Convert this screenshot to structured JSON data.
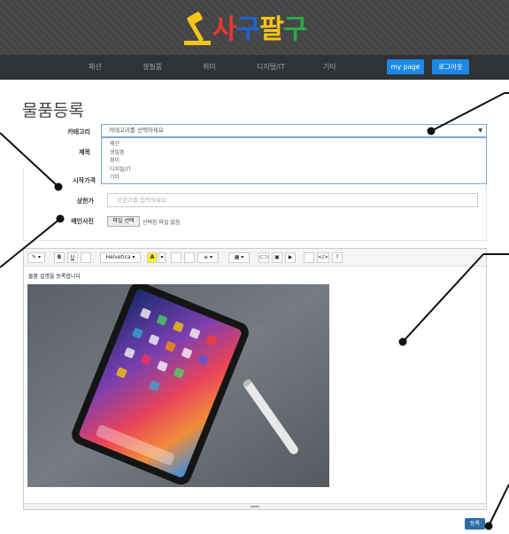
{
  "header": {
    "logo_text_1": "사",
    "logo_text_2": "구",
    "logo_text_3": "팔",
    "logo_text_4": "구",
    "nav": [
      {
        "label": "패션"
      },
      {
        "label": "생필품"
      },
      {
        "label": "취미"
      },
      {
        "label": "디지털/IT"
      },
      {
        "label": "기타"
      }
    ],
    "mypage_label": "my page",
    "logout_label": "로그아웃"
  },
  "page": {
    "title": "물품등록"
  },
  "form": {
    "category_label": "카테고리",
    "category_placeholder": "카테고리를 선택하세요",
    "category_options": [
      "패션",
      "생필품",
      "취미",
      "디지털/IT",
      "기타"
    ],
    "name_label": "제목",
    "start_price_label": "시작가격",
    "price_label": "상한가",
    "price_placeholder": "상한가를 입력하세요",
    "photo_label": "메인사진",
    "file_button_label": "파일 선택",
    "file_status": "선택된 파일 없음"
  },
  "editor": {
    "font_name": "Helvetica",
    "toolbar": [
      "B",
      "U",
      "",
      "A",
      "",
      "",
      "",
      "?"
    ],
    "content_text": "물품 설명을 등록합니다",
    "submit_label": "등록"
  },
  "colors": {
    "nav_bg": "#2f3338",
    "accent": "#1e88e5",
    "submit": "#2e6da4",
    "logo_yellow": "#f5c518",
    "logo_red": "#e53935",
    "logo_blue": "#1e63d6",
    "logo_green": "#2ea84a"
  }
}
